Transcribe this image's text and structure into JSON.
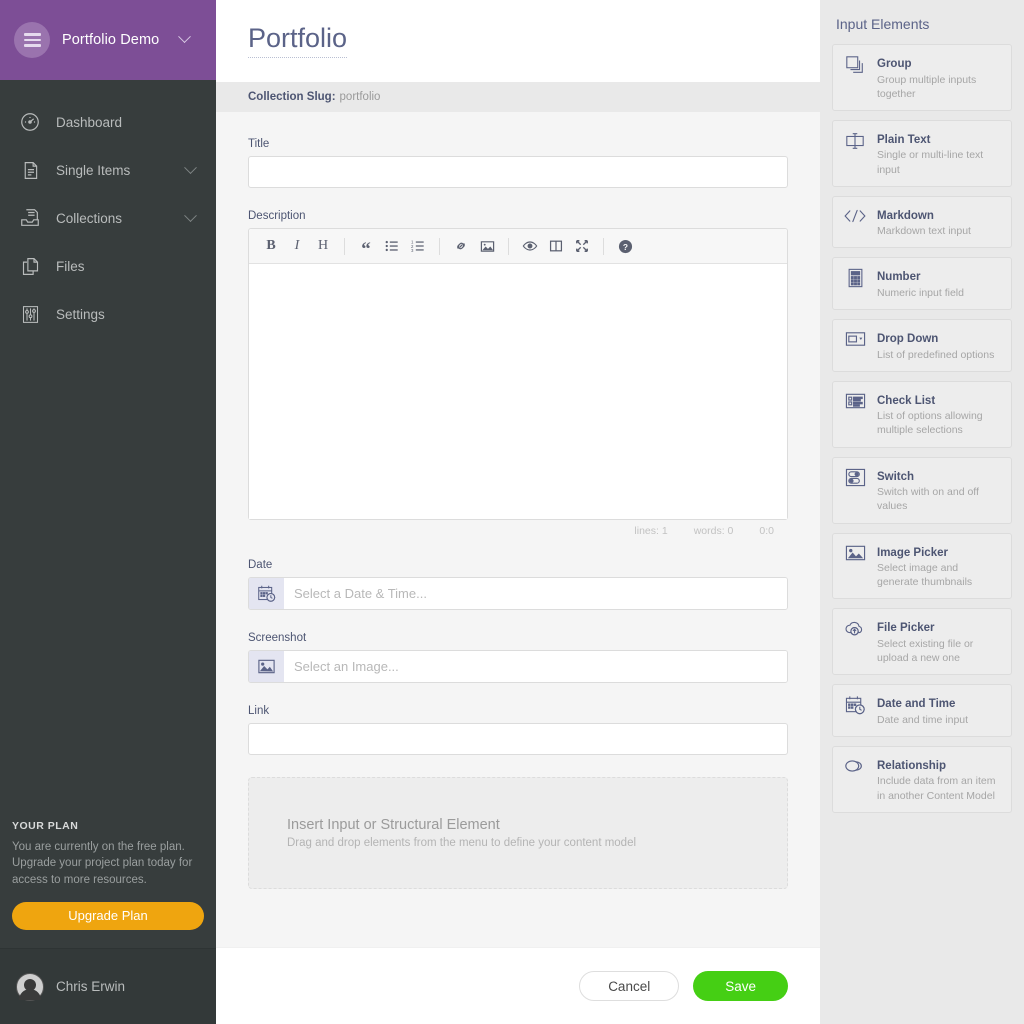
{
  "sidebar": {
    "brand": {
      "name": "Portfolio Demo",
      "menu_icon": "hamburger-icon",
      "chevron_icon": "chevron-down-icon"
    },
    "items": [
      {
        "label": "Dashboard",
        "icon": "gauge-icon",
        "expandable": false
      },
      {
        "label": "Single Items",
        "icon": "document-icon",
        "expandable": true
      },
      {
        "label": "Collections",
        "icon": "file-tray-icon",
        "expandable": true
      },
      {
        "label": "Files",
        "icon": "copy-files-icon",
        "expandable": false
      },
      {
        "label": "Settings",
        "icon": "sliders-icon",
        "expandable": false
      }
    ],
    "plan": {
      "heading": "YOUR PLAN",
      "text": "You are currently on the free plan. Upgrade your project plan today for access to more resources.",
      "button_label": "Upgrade Plan",
      "button_color": "#efa50f"
    },
    "user": {
      "name": "Chris Erwin",
      "avatar_icon": "user-avatar"
    },
    "brand_color": "#7d4e96",
    "background_color": "#373d3d"
  },
  "main": {
    "page_title": "Portfolio",
    "slug_label": "Collection Slug:",
    "slug_value": "portfolio",
    "fields": {
      "title": {
        "label": "Title",
        "value": "",
        "placeholder": ""
      },
      "description": {
        "label": "Description",
        "value": "",
        "toolbar": [
          {
            "name": "bold-icon",
            "glyph": "B"
          },
          {
            "name": "italic-icon",
            "glyph": "I"
          },
          {
            "name": "heading-icon",
            "glyph": "H"
          },
          {
            "name": "quote-icon",
            "glyph": "“"
          },
          {
            "name": "unordered-list-icon",
            "glyph": ""
          },
          {
            "name": "ordered-list-icon",
            "glyph": ""
          },
          {
            "name": "link-icon",
            "glyph": ""
          },
          {
            "name": "image-icon",
            "glyph": ""
          },
          {
            "name": "preview-eye-icon",
            "glyph": ""
          },
          {
            "name": "side-by-side-icon",
            "glyph": ""
          },
          {
            "name": "fullscreen-icon",
            "glyph": ""
          },
          {
            "name": "help-icon",
            "glyph": "?"
          }
        ],
        "status": {
          "lines": "lines: 1",
          "words": "words: 0",
          "cursor": "0:0"
        }
      },
      "date": {
        "label": "Date",
        "placeholder": "Select a Date & Time...",
        "value": "",
        "icon": "calendar-clock-icon"
      },
      "screenshot": {
        "label": "Screenshot",
        "placeholder": "Select an Image...",
        "value": "",
        "icon": "image-picker-icon"
      },
      "link": {
        "label": "Link",
        "value": "",
        "placeholder": ""
      }
    },
    "dropzone": {
      "title": "Insert Input or Structural Element",
      "subtitle": "Drag and drop elements from the menu to define your content model"
    },
    "actions": {
      "cancel_label": "Cancel",
      "save_label": "Save",
      "save_color": "#45cf14"
    }
  },
  "right_panel": {
    "title": "Input Elements",
    "elements": [
      {
        "name": "Group",
        "desc": "Group multiple inputs together",
        "icon": "stacked-squares-icon"
      },
      {
        "name": "Plain Text",
        "desc": "Single or multi-line text input",
        "icon": "text-field-icon"
      },
      {
        "name": "Markdown",
        "desc": "Markdown text input",
        "icon": "code-brackets-icon"
      },
      {
        "name": "Number",
        "desc": "Numeric input field",
        "icon": "calculator-icon"
      },
      {
        "name": "Drop Down",
        "desc": "List of predefined options",
        "icon": "dropdown-icon"
      },
      {
        "name": "Check List",
        "desc": "List of options allowing multiple selections",
        "icon": "checklist-icon"
      },
      {
        "name": "Switch",
        "desc": "Switch with on and off values",
        "icon": "toggle-switch-icon"
      },
      {
        "name": "Image Picker",
        "desc": "Select image and generate thumbnails",
        "icon": "image-picker-icon"
      },
      {
        "name": "File Picker",
        "desc": "Select existing file or upload a new one",
        "icon": "cloud-upload-icon"
      },
      {
        "name": "Date and Time",
        "desc": "Date and time input",
        "icon": "calendar-clock-icon"
      },
      {
        "name": "Relationship",
        "desc": "Include data from an item in another Content Model",
        "icon": "link-chain-icon"
      }
    ]
  }
}
